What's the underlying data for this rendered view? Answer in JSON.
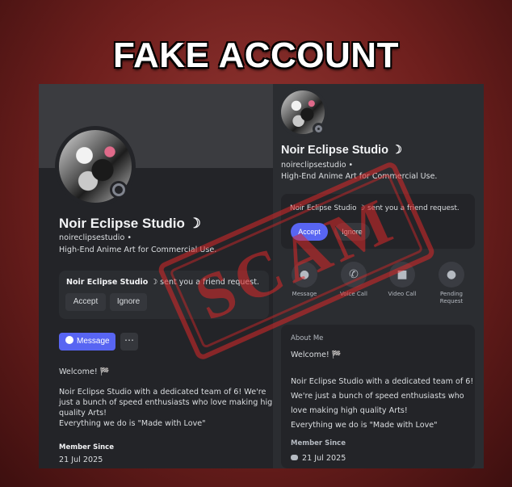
{
  "headline": "FAKE ACCOUNT",
  "left": {
    "display_name": "Noir Eclipse Studio ☽",
    "handle": "noireclipsestudio •",
    "tagline": "High-End Anime Art for Commercial Use.",
    "friend_request": {
      "sender": "Noir Eclipse Studio ☽",
      "text": "sent you a friend request."
    },
    "accept_label": "Accept",
    "ignore_label": "Ignore",
    "message_label": "Message",
    "more_label": "⋯",
    "greeting": "Welcome! 🏁",
    "about_lines": [
      "Noir Eclipse Studio with a dedicated team of 6! We're",
      "just a bunch of speed enthusiasts who love making high",
      "quality Arts!",
      "Everything we do is \"Made with Love\""
    ],
    "member_since_label": "Member Since",
    "member_since_date": "21 Jul 2025"
  },
  "right": {
    "display_name": "Noir Eclipse Studio ☽",
    "handle": "noireclipsestudio •",
    "tagline": "High-End Anime Art for Commercial Use.",
    "friend_request": {
      "sender": "Noir Eclipse Studio ☽",
      "text": "sent you a friend request."
    },
    "accept_label": "Accept",
    "ignore_label": "Ignore",
    "actions": [
      {
        "label": "Message",
        "icon": "chat-bubble-icon"
      },
      {
        "label": "Voice Call",
        "icon": "phone-icon"
      },
      {
        "label": "Video Call",
        "icon": "video-camera-icon"
      },
      {
        "label": "Pending Request",
        "icon": "pending-friend-icon"
      }
    ],
    "about_me_label": "About Me",
    "greeting": "Welcome! 🏁",
    "about_lines": [
      "Noir Eclipse Studio with a dedicated team of 6!",
      "We're just a bunch of speed enthusiasts who",
      "love making high quality Arts!",
      "Everything we do is \"Made with Love\""
    ],
    "member_since_label": "Member Since",
    "member_since_date": "21 Jul 2025"
  },
  "stamp_text": "SCAM",
  "colors": {
    "accent": "#5865f2",
    "stamp": "#dc2828",
    "panel": "#232428"
  }
}
